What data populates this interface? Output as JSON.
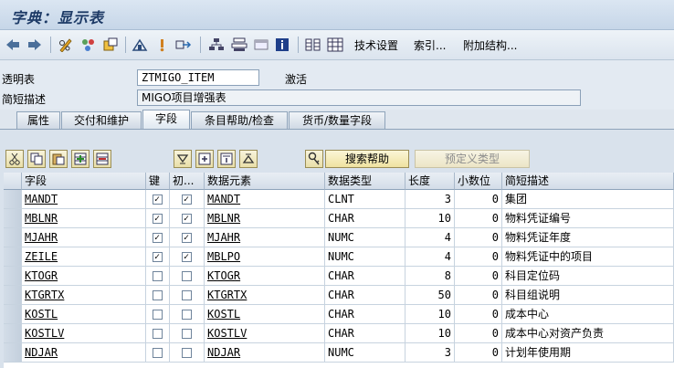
{
  "window": {
    "title": "字典：显示表"
  },
  "toolbar": {
    "icons": [
      "arrow-left-icon",
      "arrow-right-icon",
      "pencil-glasses-icon",
      "display-change-icon",
      "check-object-icon",
      "activate-icon",
      "where-used-icon",
      "navigate-icon",
      "hierarchy-icon",
      "object-list-icon",
      "window-icon",
      "info-icon",
      "technical-settings-icon",
      "grid-icon"
    ],
    "tech_settings": "技术设置",
    "indexes": "索引...",
    "append_structure": "附加结构..."
  },
  "form": {
    "transparent_table_label": "透明表",
    "table_name": "ZTMIGO_ITEM",
    "status": "激活",
    "short_desc_label": "简短描述",
    "short_desc": "MIGO项目增强表"
  },
  "tabs": [
    "属性",
    "交付和维护",
    "字段",
    "条目帮助/检查",
    "货币/数量字段"
  ],
  "active_tab": "字段",
  "buttons": {
    "search_help": "搜索帮助",
    "predefined_type": "预定义类型"
  },
  "table": {
    "headers": [
      "字段",
      "键",
      "初...",
      "数据元素",
      "数据类型",
      "长度",
      "小数位",
      "简短描述"
    ],
    "rows": [
      {
        "field": "MANDT",
        "key": true,
        "init": true,
        "element": "MANDT",
        "type": "CLNT",
        "length": "3",
        "decimals": "0",
        "desc": "集团"
      },
      {
        "field": "MBLNR",
        "key": true,
        "init": true,
        "element": "MBLNR",
        "type": "CHAR",
        "length": "10",
        "decimals": "0",
        "desc": "物料凭证编号"
      },
      {
        "field": "MJAHR",
        "key": true,
        "init": true,
        "element": "MJAHR",
        "type": "NUMC",
        "length": "4",
        "decimals": "0",
        "desc": "物料凭证年度"
      },
      {
        "field": "ZEILE",
        "key": true,
        "init": true,
        "element": "MBLPO",
        "type": "NUMC",
        "length": "4",
        "decimals": "0",
        "desc": "物料凭证中的项目"
      },
      {
        "field": "KTOGR",
        "key": false,
        "init": false,
        "element": "KTOGR",
        "type": "CHAR",
        "length": "8",
        "decimals": "0",
        "desc": "科目定位码"
      },
      {
        "field": "KTGRTX",
        "key": false,
        "init": false,
        "element": "KTGRTX",
        "type": "CHAR",
        "length": "50",
        "decimals": "0",
        "desc": "科目组说明"
      },
      {
        "field": "KOSTL",
        "key": false,
        "init": false,
        "element": "KOSTL",
        "type": "CHAR",
        "length": "10",
        "decimals": "0",
        "desc": "成本中心"
      },
      {
        "field": "KOSTLV",
        "key": false,
        "init": false,
        "element": "KOSTLV",
        "type": "CHAR",
        "length": "10",
        "decimals": "0",
        "desc": "成本中心对资产负责"
      },
      {
        "field": "NDJAR",
        "key": false,
        "init": false,
        "element": "NDJAR",
        "type": "NUMC",
        "length": "3",
        "decimals": "0",
        "desc": "计划年使用期"
      }
    ]
  },
  "check_mark": "✓",
  "colors": {
    "accent": "#1d3a66",
    "checkbox_border": "#6f849b"
  }
}
